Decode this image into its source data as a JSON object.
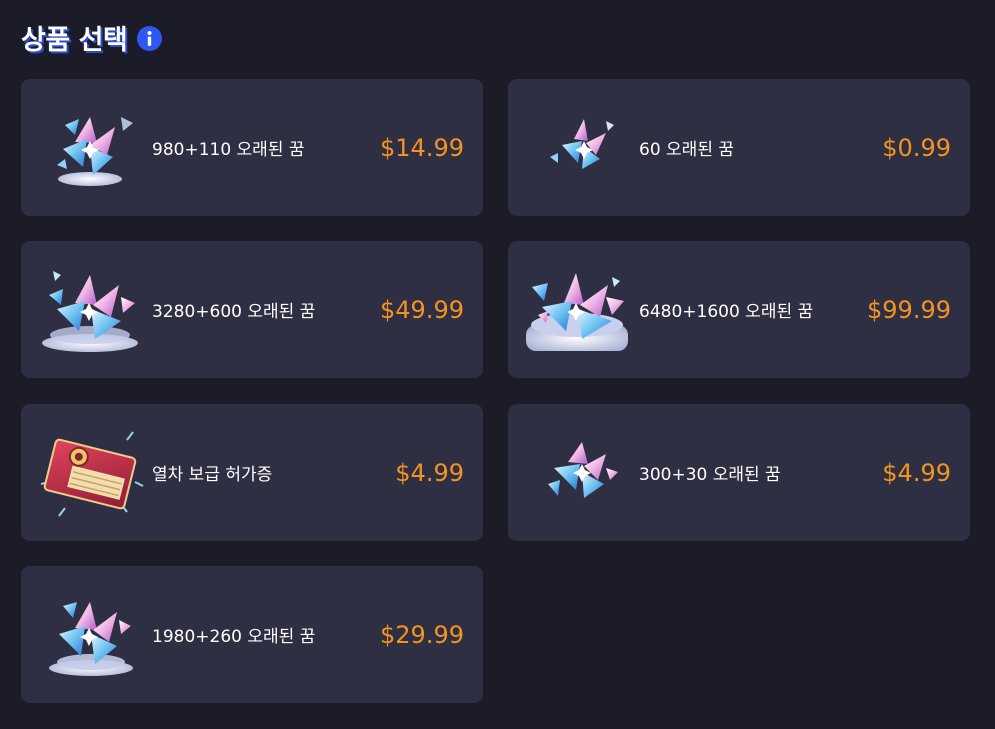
{
  "header": {
    "title": "상품 선택",
    "info_icon": "info-icon"
  },
  "colors": {
    "background": "#1b1c27",
    "card": "#2e2f42",
    "price": "#f39421",
    "info_accent": "#2f57f5"
  },
  "products": [
    {
      "name": "980+110 오래된 꿈",
      "price": "$14.99",
      "icon": "dream-crystal-medium-icon"
    },
    {
      "name": "60 오래된 꿈",
      "price": "$0.99",
      "icon": "dream-crystal-small-icon"
    },
    {
      "name": "3280+600 오래된 꿈",
      "price": "$49.99",
      "icon": "dream-crystal-large-icon"
    },
    {
      "name": "6480+1600 오래된 꿈",
      "price": "$99.99",
      "icon": "dream-crystal-huge-icon"
    },
    {
      "name": "열차 보급 허가증",
      "price": "$4.99",
      "icon": "supply-pass-icon"
    },
    {
      "name": "300+30 오래된 꿈",
      "price": "$4.99",
      "icon": "dream-crystal-cluster-icon"
    },
    {
      "name": "1980+260 오래된 꿈",
      "price": "$29.99",
      "icon": "dream-crystal-pile-icon"
    }
  ]
}
